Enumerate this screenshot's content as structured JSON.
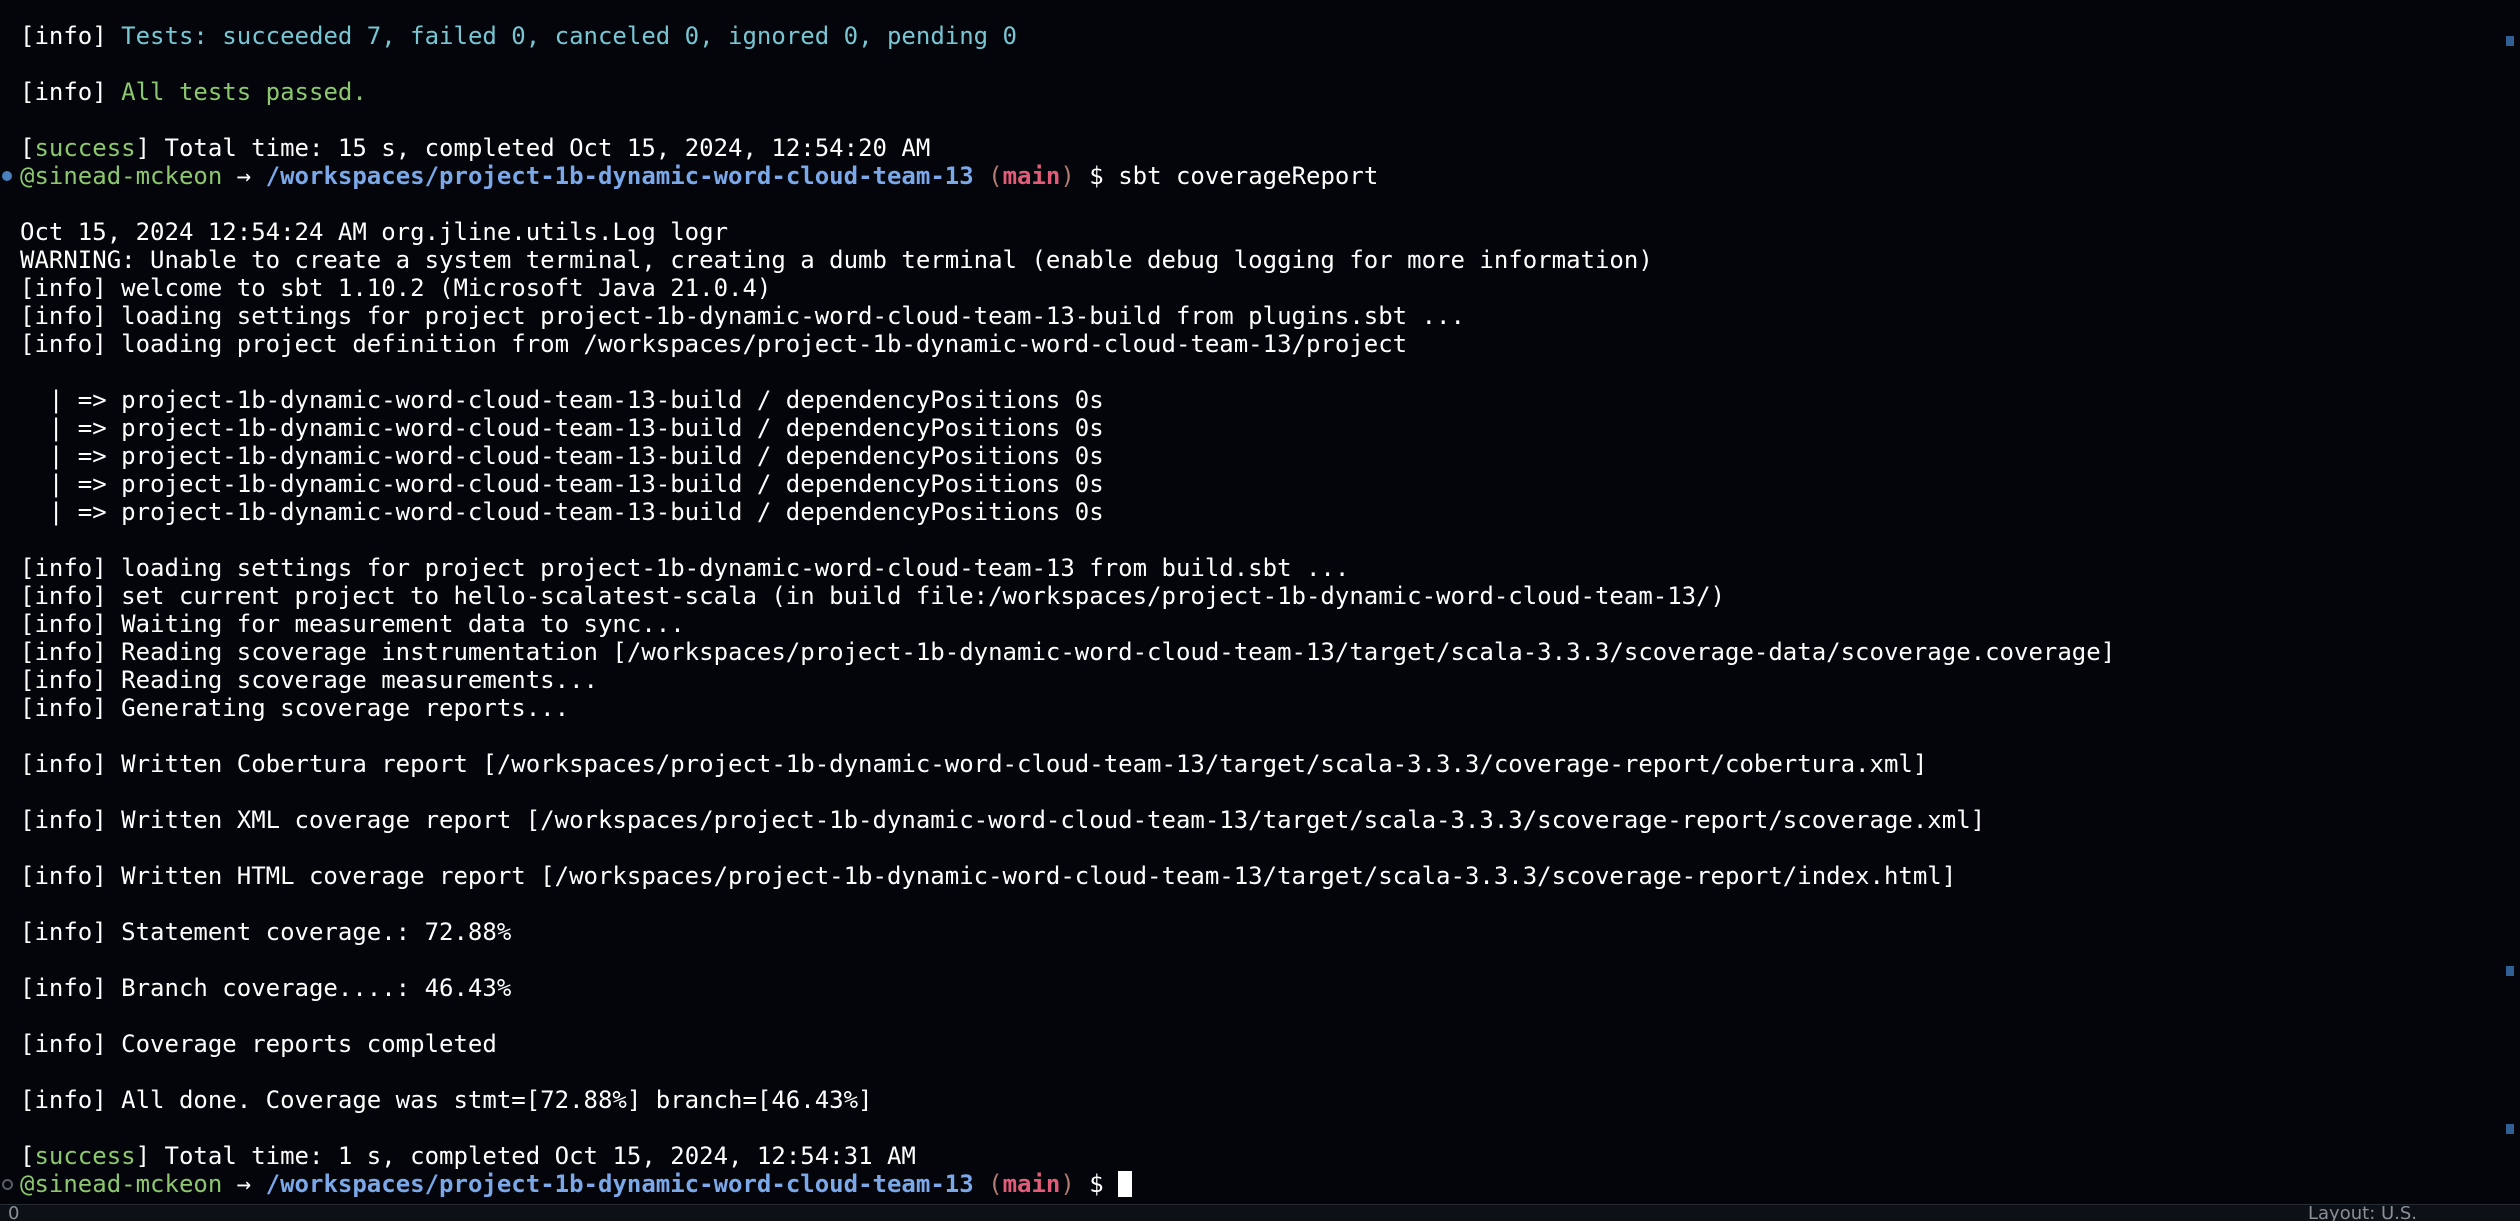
{
  "terminal": {
    "prompt": {
      "user": "@sinead-mckeon",
      "arrow": "→",
      "path": "/workspaces/project-1b-dynamic-word-cloud-team-13",
      "branch": "main",
      "symbol": "$"
    },
    "lines": {
      "l01_tag": "[info]",
      "l01_text": "Tests: succeeded 7, failed 0, canceled 0, ignored 0, pending 0",
      "l02_tag": "[info]",
      "l02_text": "All tests passed.",
      "l03_tag_open": "[",
      "l03_tag_word": "success",
      "l03_tag_close": "]",
      "l03_text": "Total time: 15 s, completed Oct 15, 2024, 12:54:20 AM",
      "cmd1": "sbt coverageReport",
      "l05": "Oct 15, 2024 12:54:24 AM org.jline.utils.Log logr",
      "l06": "WARNING: Unable to create a system terminal, creating a dumb terminal (enable debug logging for more information)",
      "l07": "[info] welcome to sbt 1.10.2 (Microsoft Java 21.0.4)",
      "l08": "[info] loading settings for project project-1b-dynamic-word-cloud-team-13-build from plugins.sbt ...",
      "l09": "[info] loading project definition from /workspaces/project-1b-dynamic-word-cloud-team-13/project",
      "dep": "  | => project-1b-dynamic-word-cloud-team-13-build / dependencyPositions 0s",
      "l16": "[info] loading settings for project project-1b-dynamic-word-cloud-team-13 from build.sbt ...",
      "l17": "[info] set current project to hello-scalatest-scala (in build file:/workspaces/project-1b-dynamic-word-cloud-team-13/)",
      "l18": "[info] Waiting for measurement data to sync...",
      "l19": "[info] Reading scoverage instrumentation [/workspaces/project-1b-dynamic-word-cloud-team-13/target/scala-3.3.3/scoverage-data/scoverage.coverage]",
      "l20": "[info] Reading scoverage measurements...",
      "l21": "[info] Generating scoverage reports...",
      "l22": "[info] Written Cobertura report [/workspaces/project-1b-dynamic-word-cloud-team-13/target/scala-3.3.3/coverage-report/cobertura.xml]",
      "l23": "[info] Written XML coverage report [/workspaces/project-1b-dynamic-word-cloud-team-13/target/scala-3.3.3/scoverage-report/scoverage.xml]",
      "l24": "[info] Written HTML coverage report [/workspaces/project-1b-dynamic-word-cloud-team-13/target/scala-3.3.3/scoverage-report/index.html]",
      "l25": "[info] Statement coverage.: 72.88%",
      "l26": "[info] Branch coverage....: 46.43%",
      "l27": "[info] Coverage reports completed",
      "l28": "[info] All done. Coverage was stmt=[72.88%] branch=[46.43%]",
      "l29_tag_open": "[",
      "l29_tag_word": "success",
      "l29_tag_close": "]",
      "l29_text": "Total time: 1 s, completed Oct 15, 2024, 12:54:31 AM"
    }
  },
  "statusbar": {
    "left": "0",
    "right": "Layout: U.S."
  },
  "colors": {
    "background": "#03050b",
    "info_cyan": "#79c6d3",
    "success_green": "#8cc76f",
    "path_blue": "#7aa8e8",
    "branch_red": "#e35b79"
  }
}
